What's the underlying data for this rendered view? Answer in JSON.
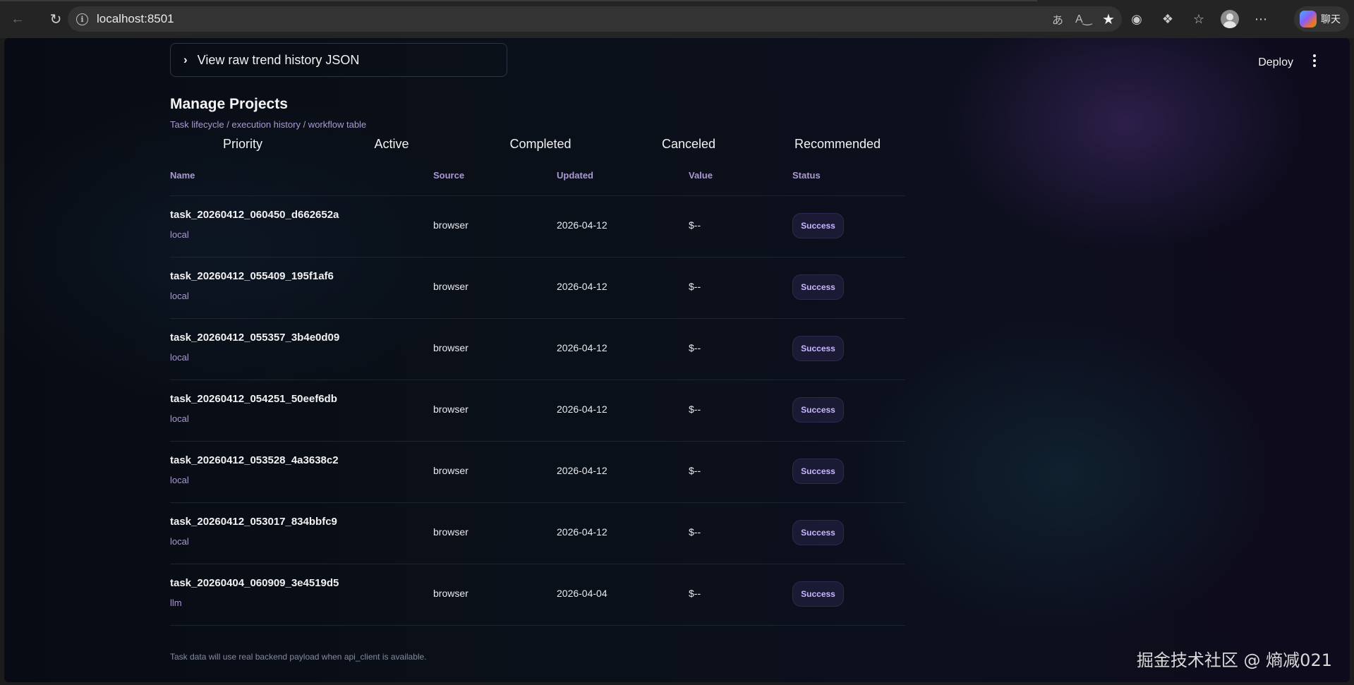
{
  "browser": {
    "url": "localhost:8501",
    "copilot_label": "聊天"
  },
  "app": {
    "deploy_label": "Deploy",
    "expander_label": "View raw trend history JSON",
    "title": "Manage Projects",
    "subtitle": "Task lifecycle / execution history / workflow table",
    "tabs": [
      "Priority",
      "Active",
      "Completed",
      "Canceled",
      "Recommended"
    ],
    "columns": {
      "name": "Name",
      "source": "Source",
      "updated": "Updated",
      "value": "Value",
      "status": "Status"
    },
    "rows": [
      {
        "name": "task_20260412_060450_d662652a",
        "kind": "local",
        "source": "browser",
        "updated": "2026-04-12",
        "value": "$--",
        "status": "Success"
      },
      {
        "name": "task_20260412_055409_195f1af6",
        "kind": "local",
        "source": "browser",
        "updated": "2026-04-12",
        "value": "$--",
        "status": "Success"
      },
      {
        "name": "task_20260412_055357_3b4e0d09",
        "kind": "local",
        "source": "browser",
        "updated": "2026-04-12",
        "value": "$--",
        "status": "Success"
      },
      {
        "name": "task_20260412_054251_50eef6db",
        "kind": "local",
        "source": "browser",
        "updated": "2026-04-12",
        "value": "$--",
        "status": "Success"
      },
      {
        "name": "task_20260412_053528_4a3638c2",
        "kind": "local",
        "source": "browser",
        "updated": "2026-04-12",
        "value": "$--",
        "status": "Success"
      },
      {
        "name": "task_20260412_053017_834bbfc9",
        "kind": "local",
        "source": "browser",
        "updated": "2026-04-12",
        "value": "$--",
        "status": "Success"
      },
      {
        "name": "task_20260404_060909_3e4519d5",
        "kind": "llm",
        "source": "browser",
        "updated": "2026-04-04",
        "value": "$--",
        "status": "Success"
      }
    ],
    "footnote": "Task data will use real backend payload when api_client is available."
  },
  "watermark": "掘金技术社区 @ 熵减021",
  "colors": {
    "accent_text": "#a99bd0",
    "badge_text": "#c8b6ff",
    "badge_bg": "#1b1a34"
  }
}
